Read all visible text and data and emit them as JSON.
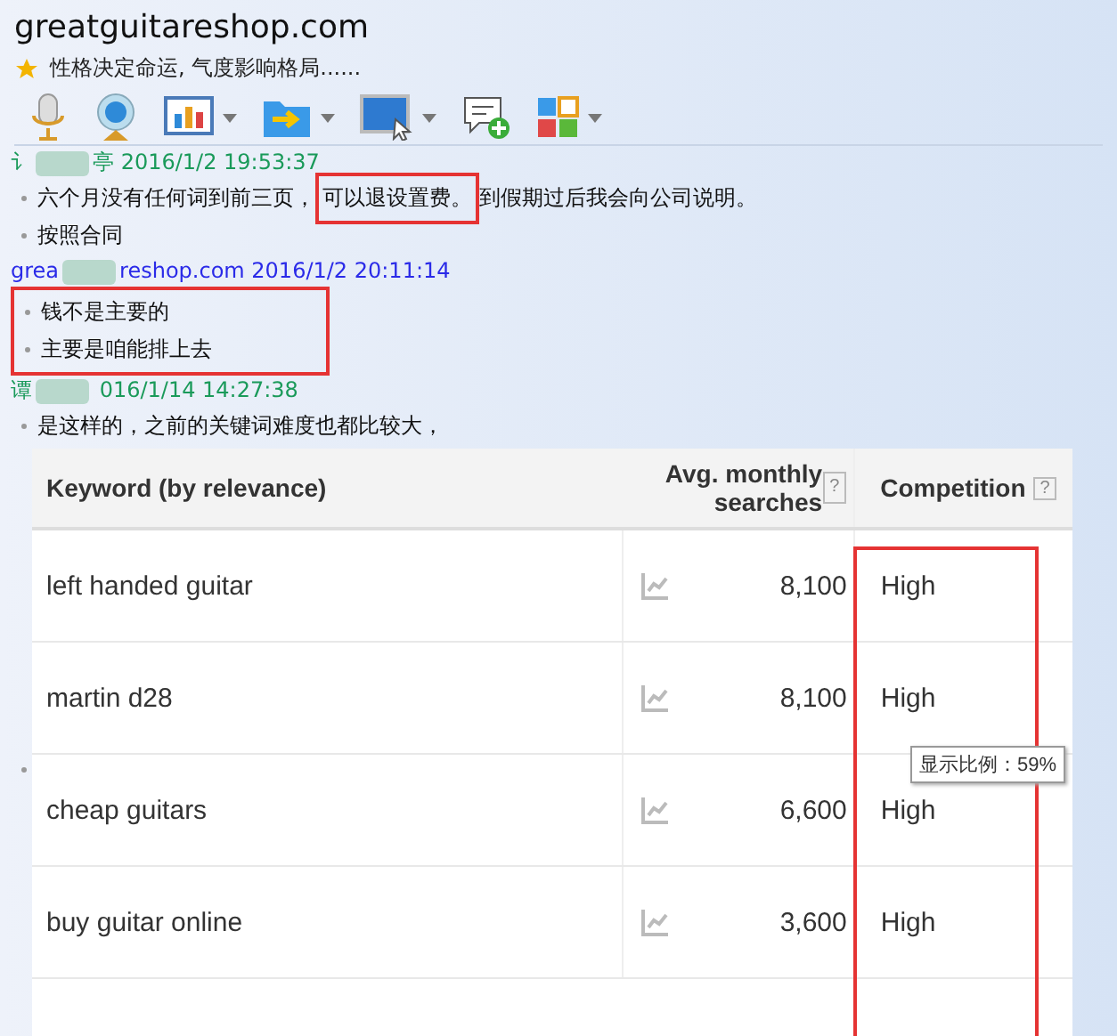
{
  "window": {
    "title": "greatguitareshop.com",
    "signature": "性格决定命运, 气度影响格局......"
  },
  "toolbar": [
    {
      "kind": "mic",
      "menu": false
    },
    {
      "kind": "camera",
      "menu": false
    },
    {
      "kind": "screen",
      "menu": true
    },
    {
      "kind": "folder",
      "menu": true
    },
    {
      "kind": "remote",
      "menu": true
    },
    {
      "kind": "message",
      "menu": false
    },
    {
      "kind": "apps",
      "menu": true
    }
  ],
  "messages": [
    {
      "sender_start": "讠",
      "sender_end": "亭",
      "time": "2016/1/2 19:53:37",
      "color": "#1a9a5a",
      "highlighted": false,
      "lines": [
        [
          "六个月没有任何词到前三页，",
          "可以退设置费。",
          "到假期过后我会向公司说明。"
        ],
        [
          "按照合同"
        ]
      ]
    },
    {
      "sender_start": "grea",
      "sender_end": "reshop.com",
      "time": "2016/1/2 20:11:14",
      "color": "#2a2ae8",
      "highlighted": true,
      "lines": [
        [
          "钱不是主要的"
        ],
        [
          "主要是咱能排上去"
        ]
      ]
    },
    {
      "sender_start": "谭",
      "time": "016/1/14 14:27:38",
      "color": "#1a9a5a",
      "highlighted": false,
      "lines": [
        [
          "是这样的，之前的关键词难度也都比较大，"
        ]
      ]
    }
  ],
  "table": {
    "columns": [
      {
        "label": "Keyword (by relevance)"
      },
      {
        "label": "Avg. monthly searches",
        "help": "?"
      },
      {
        "label": "Competition",
        "help": "?"
      }
    ],
    "rows": [
      {
        "keyword": "left handed guitar",
        "searches": "8,100",
        "competition": "High"
      },
      {
        "keyword": "martin d28",
        "searches": "8,100",
        "competition": "High"
      },
      {
        "keyword": "cheap guitars",
        "searches": "6,600",
        "competition": "High"
      },
      {
        "keyword": "buy guitar online",
        "searches": "3,600",
        "competition": "High"
      }
    ]
  },
  "tooltip": "显示比例：59%"
}
